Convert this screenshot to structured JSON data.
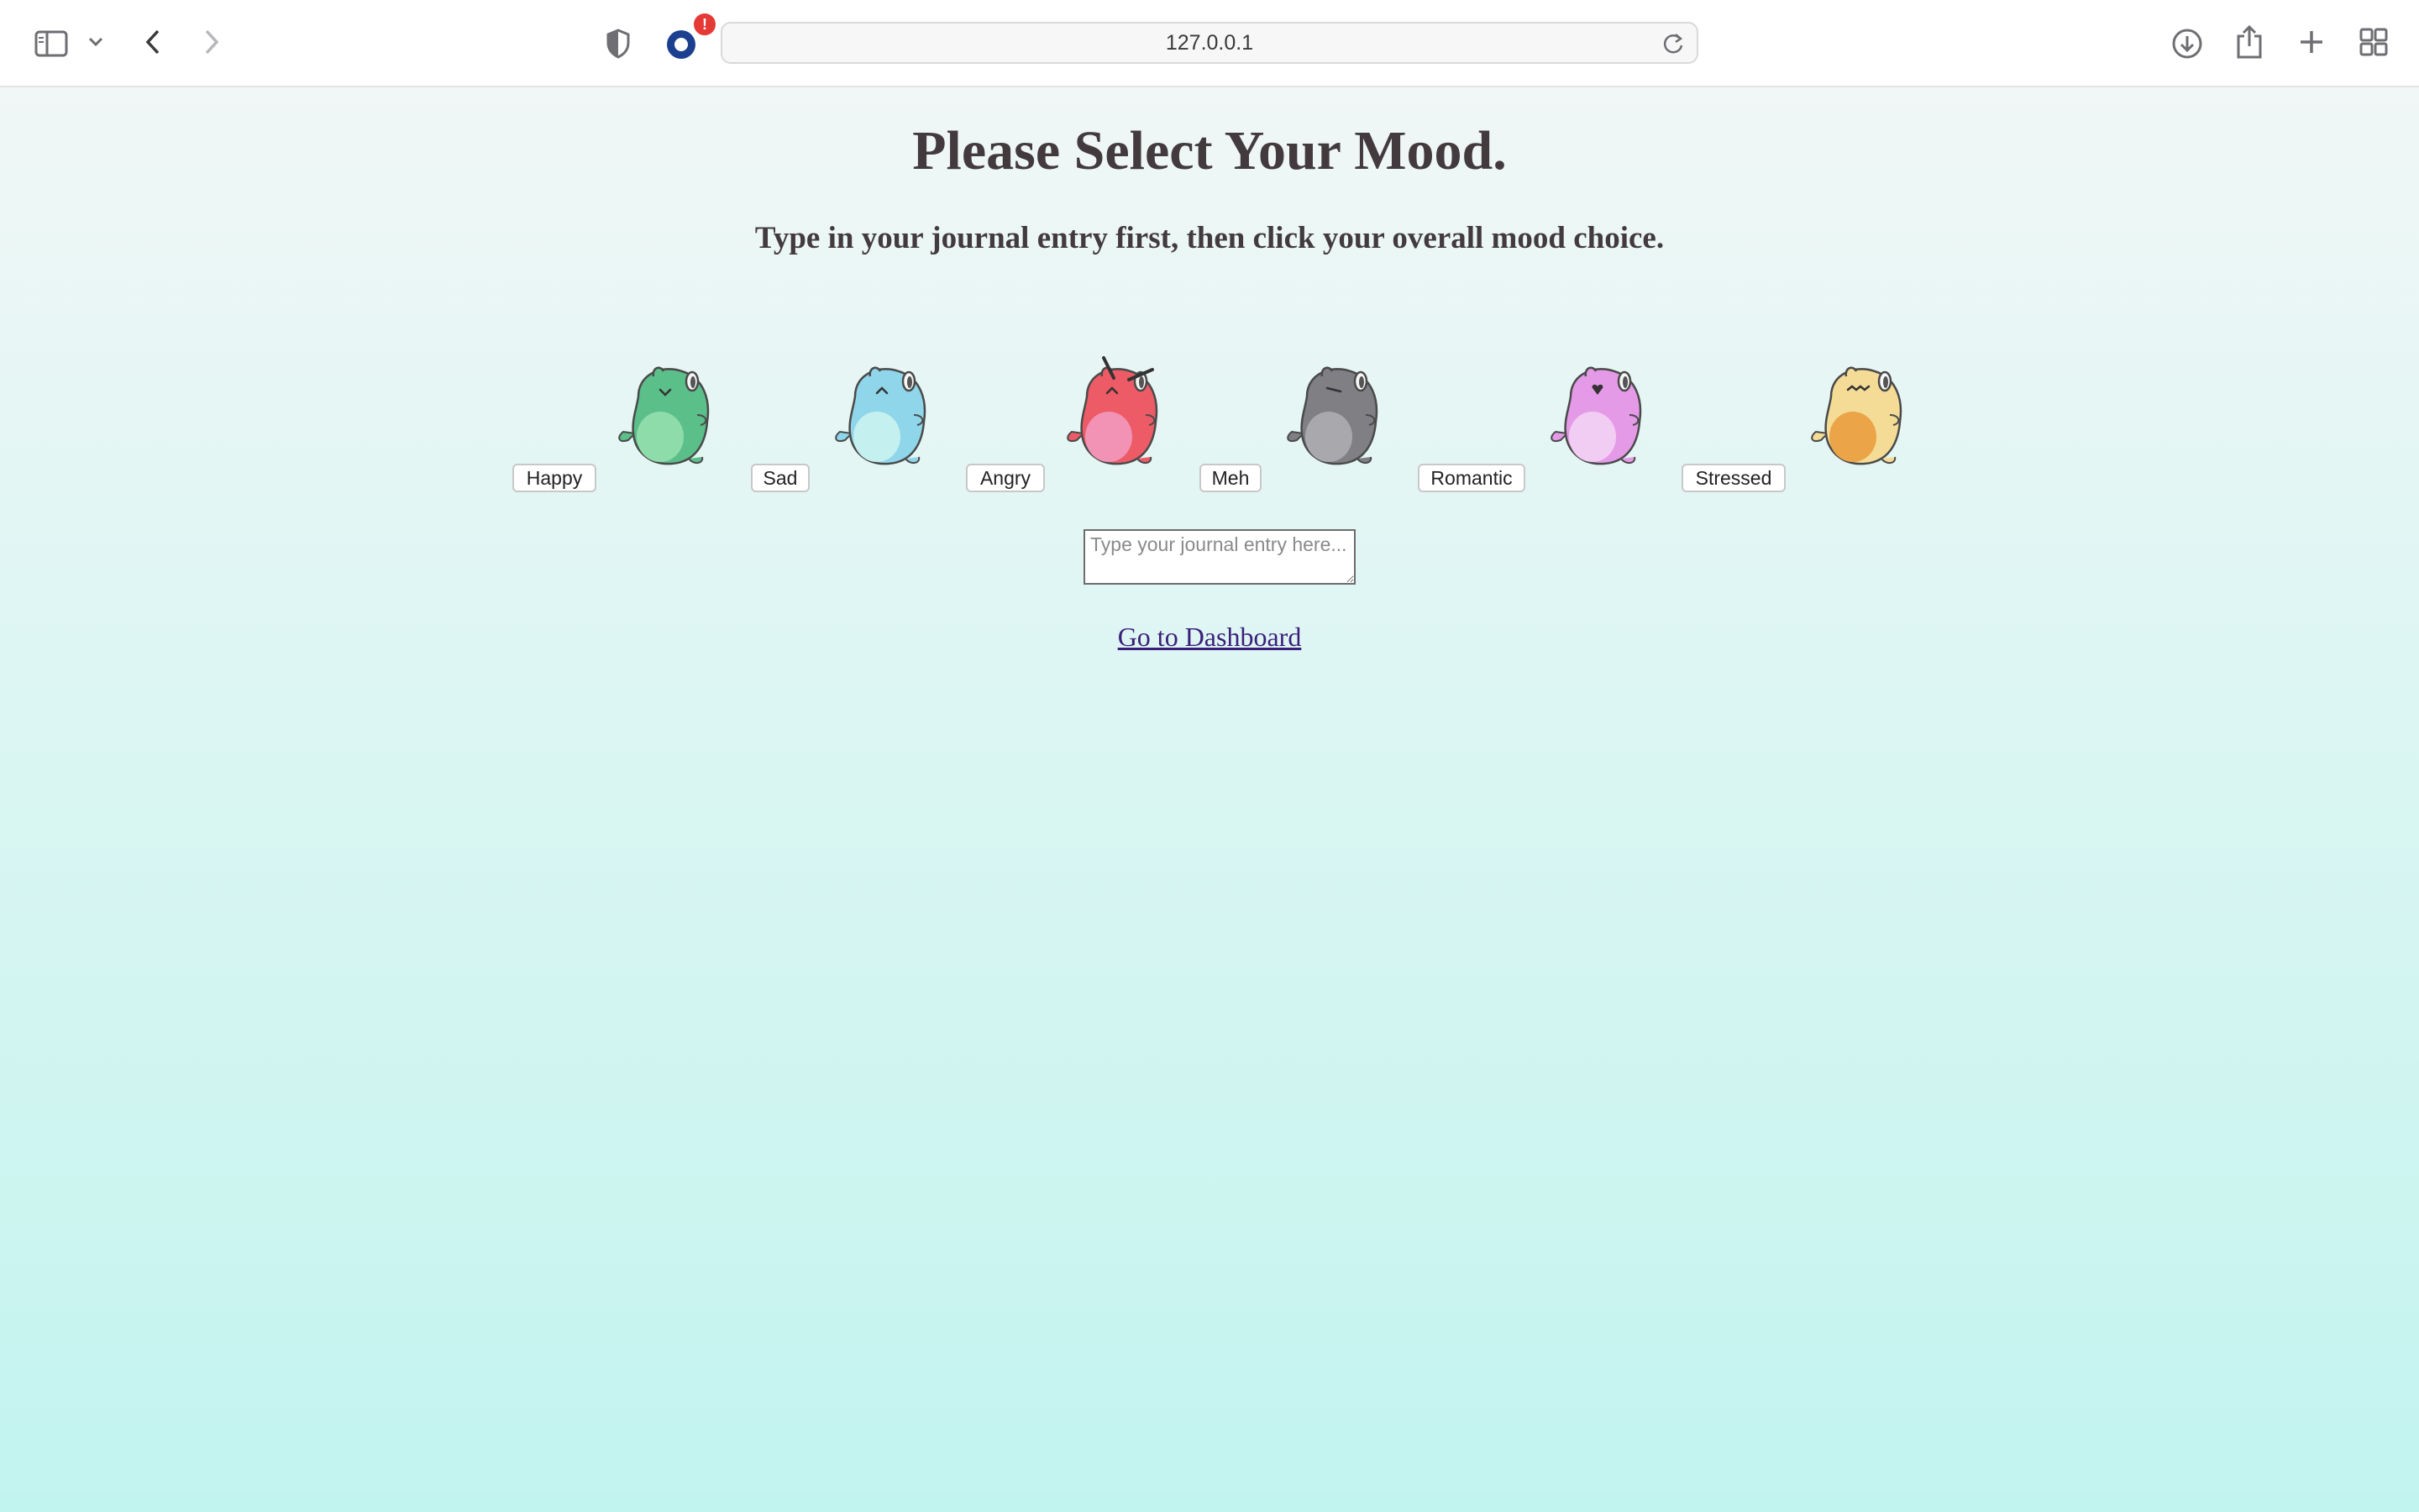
{
  "browser": {
    "url": "127.0.0.1",
    "badge": "!"
  },
  "page": {
    "title": "Please Select Your Mood.",
    "subtitle": "Type in your journal entry first, then click your overall mood choice.",
    "moods": [
      {
        "label": "Happy",
        "color": "#5bbf8a",
        "belly": "#8fdcab",
        "face": "happy"
      },
      {
        "label": "Sad",
        "color": "#8fd6ea",
        "belly": "#c4f1ef",
        "face": "sad"
      },
      {
        "label": "Angry",
        "color": "#ec5b66",
        "belly": "#f292b4",
        "face": "angry"
      },
      {
        "label": "Meh",
        "color": "#7f7f84",
        "belly": "#a9a9ad",
        "face": "meh"
      },
      {
        "label": "Romantic",
        "color": "#e59ae8",
        "belly": "#f2cdf3",
        "face": "romantic"
      },
      {
        "label": "Stressed",
        "color": "#f4dc96",
        "belly": "#eba447",
        "face": "stressed"
      }
    ],
    "journal": {
      "placeholder": "Type your journal entry here...",
      "value": ""
    },
    "dashboard_link": "Go to Dashboard"
  }
}
